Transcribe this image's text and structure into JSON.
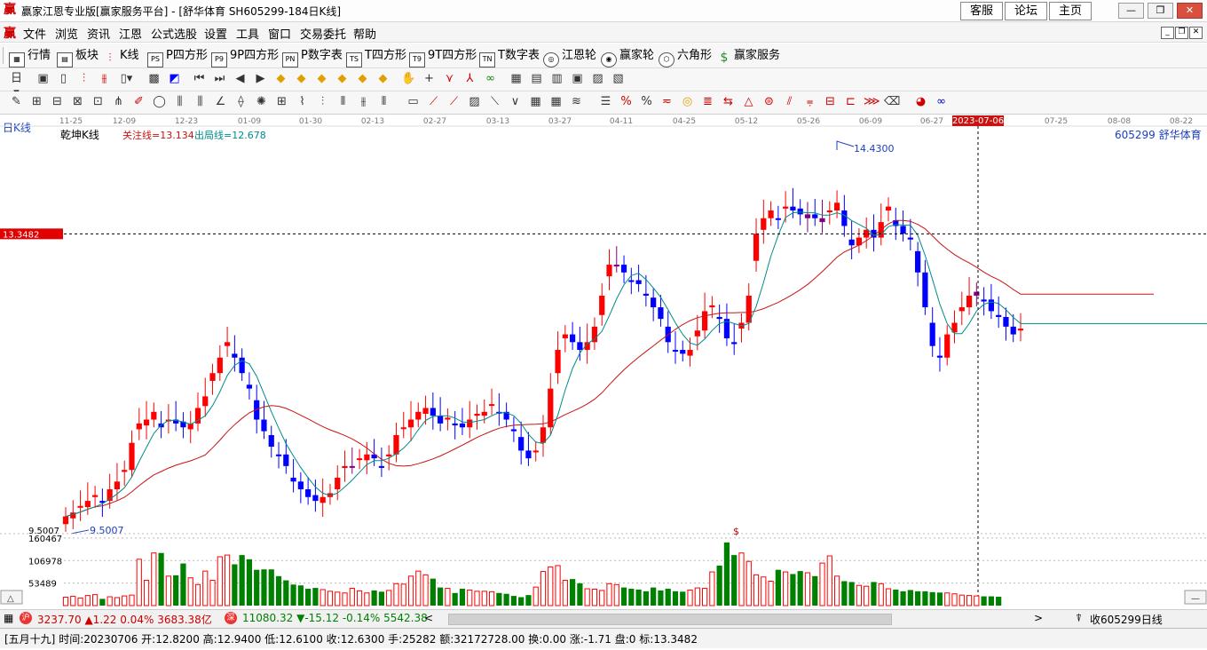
{
  "window": {
    "title": "赢家江恩专业版[赢家服务平台] - [舒华体育  SH605299-184日K线]",
    "top_links": [
      "客服",
      "论坛",
      "主页"
    ],
    "controls": [
      "—",
      "❐",
      "✕"
    ]
  },
  "menu": [
    "文件",
    "浏览",
    "资讯",
    "江恩",
    "公式选股",
    "设置",
    "工具",
    "窗口",
    "交易委托",
    "帮助"
  ],
  "toolbar": [
    "行情",
    "板块",
    "K线",
    "P四方形",
    "9P四方形",
    "P数字表",
    "T四方形",
    "9T四方形",
    "T数字表",
    "江恩轮",
    "赢家轮",
    "六角形",
    "赢家服务"
  ],
  "toolbar_icon_text": [
    "PS",
    "P9",
    "PN",
    "TS",
    "T9",
    "TN",
    "$"
  ],
  "chart": {
    "period_tag": "日K线",
    "indicator_name": "乾坤K线",
    "focus_line": "关注线=13.134",
    "exit_line": "出局线=12.678",
    "stock_label": "605299  舒华体育",
    "cursor_price": "13.3482",
    "high_label": "14.4300",
    "low_label": "9.5007",
    "low_axis_label": "9.5007",
    "cursor_date": "2023-07-06",
    "date_ticks": [
      "11-25",
      "12-09",
      "12-23",
      "01-09",
      "01-30",
      "02-13",
      "02-27",
      "03-13",
      "03-27",
      "04-11",
      "04-25",
      "05-12",
      "05-26",
      "06-09",
      "06-27",
      "08-08",
      "07-25",
      "08-22"
    ],
    "volume_ticks": [
      "160467",
      "106978",
      "53489"
    ],
    "dollar_mark": "$",
    "colors": {
      "up": "#ff0000",
      "down": "#0000ff",
      "neutral": "#800080",
      "ma_short": "#008b8b",
      "ma_long": "#c81414",
      "volume_down": "#008000"
    }
  },
  "chart_data": {
    "type": "candlestick",
    "title": "舒华体育 605299 日K线",
    "ylim": [
      9.5,
      14.43
    ],
    "focus_line": 13.134,
    "exit_line": 12.678,
    "price_high": 14.43,
    "price_low": 9.5007,
    "cursor_date": "2023-07-06",
    "close_series": [
      9.7,
      9.75,
      9.82,
      9.9,
      9.95,
      9.9,
      10.05,
      10.15,
      10.3,
      10.65,
      10.9,
      10.95,
      11.05,
      10.85,
      10.95,
      10.9,
      10.85,
      10.9,
      11.1,
      11.25,
      11.55,
      11.75,
      11.95,
      11.75,
      11.55,
      11.35,
      10.95,
      10.8,
      10.6,
      10.5,
      10.35,
      10.15,
      10.05,
      9.95,
      9.9,
      9.95,
      10.0,
      10.2,
      10.35,
      10.35,
      10.45,
      10.5,
      10.45,
      10.35,
      10.5,
      10.75,
      10.85,
      10.95,
      11.05,
      11.1,
      11.0,
      10.9,
      10.95,
      10.9,
      10.85,
      10.95,
      11.0,
      11.05,
      11.15,
      11.05,
      10.95,
      10.8,
      10.55,
      10.45,
      10.55,
      10.85,
      11.35,
      11.85,
      12.05,
      11.95,
      11.85,
      11.95,
      12.15,
      12.55,
      12.95,
      12.95,
      12.85,
      12.75,
      12.7,
      12.55,
      12.4,
      12.25,
      11.95,
      11.85,
      11.8,
      11.85,
      12.1,
      12.35,
      12.4,
      12.25,
      12.0,
      11.95,
      12.2,
      12.55,
      13.35,
      13.55,
      13.65,
      13.55,
      13.7,
      13.65,
      13.6,
      13.6,
      13.55,
      13.55,
      13.65,
      13.75,
      13.45,
      13.2,
      13.3,
      13.4,
      13.3,
      13.5,
      13.7,
      13.45,
      13.35,
      13.3,
      12.85,
      12.4,
      11.9,
      11.75,
      12.05,
      12.2,
      12.4,
      12.55,
      12.55,
      12.5,
      12.35,
      12.3,
      12.15,
      12.05,
      12.1
    ],
    "close_series_note_dates": [
      "11-25",
      "08-22"
    ],
    "volume_series": [
      20000,
      22000,
      18000,
      24000,
      26000,
      16000,
      21000,
      19000,
      23000,
      25000,
      110000,
      60000,
      125000,
      125000,
      70000,
      72000,
      100000,
      66000,
      50000,
      82000,
      60000,
      116000,
      120000,
      98000,
      120000,
      110000,
      85000,
      86000,
      86000,
      70000,
      60000,
      50000,
      48000,
      40000,
      42000,
      38000,
      34000,
      32000,
      30000,
      41000,
      35000,
      30000,
      36000,
      33000,
      36000,
      52000,
      51000,
      70000,
      82000,
      73000,
      64000,
      43000,
      41000,
      30000,
      40000,
      37000,
      34000,
      34000,
      33000,
      30000,
      28000,
      23000,
      20000,
      25000,
      44000,
      81000,
      92000,
      95000,
      60000,
      63000,
      53000,
      40000,
      39000,
      36000,
      52000,
      50000,
      43000,
      40000,
      38000,
      34000,
      43000,
      36000,
      40000,
      34000,
      33000,
      37000,
      42000,
      41000,
      80000,
      95000,
      150000,
      120000,
      125000,
      105000,
      73000,
      68000,
      58000,
      85000,
      80000,
      75000,
      82000,
      78000,
      70000,
      101000,
      118000,
      70000,
      58000,
      56000,
      48000,
      46000,
      56000,
      52000,
      40000,
      38000,
      34000,
      37000,
      34000,
      34000,
      32000,
      31000,
      30000,
      28000,
      25000,
      24000,
      23000,
      22000,
      22000,
      21000
    ],
    "ma_short_reference": [
      9.8,
      11.2,
      10.3,
      10.7,
      10.9,
      13.5,
      13.3,
      12.0,
      12.0
    ],
    "volume_ticks": [
      53489,
      106978,
      160467
    ]
  },
  "quotes": {
    "sh_index": "3237.70",
    "sh_change": "▲1.22",
    "sh_pct": "0.04%",
    "sh_amount": "3683.38亿",
    "sz_index": "11080.32",
    "sz_change": "▼-15.12",
    "sz_pct": "-0.14%",
    "sz_amount": "5542.38",
    "sz_badge": "深"
  },
  "scroll": {
    "left_arrow": "<",
    "right_arrow": ">",
    "right_text": "收605299日线"
  },
  "status": {
    "lunar": "[五月十九]",
    "time": "时间:20230706",
    "open": "开:12.8200",
    "high": "高:12.9400",
    "low": "低:12.6100",
    "close": "收:12.6300",
    "volume": "手:25282",
    "amount": "额:32172728.00",
    "turnover": "换:0.00",
    "change": "涨:-1.71",
    "pan": "盘:0",
    "mark": "标:13.3482"
  }
}
